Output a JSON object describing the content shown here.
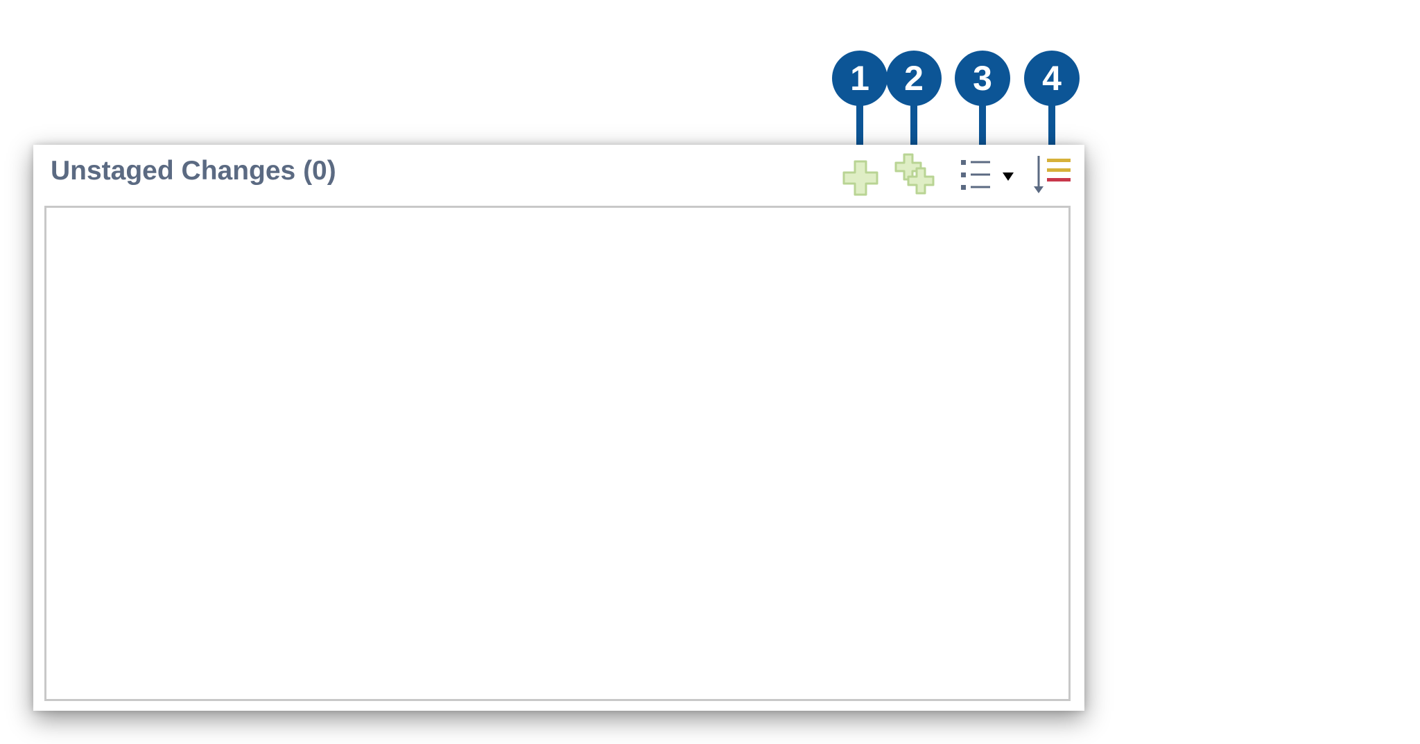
{
  "panel": {
    "title": "Unstaged Changes (0)"
  },
  "toolbar": {
    "icons": [
      "add-icon",
      "add-all-icon",
      "presentation-list-icon",
      "sort-icon"
    ],
    "colors": {
      "add_green_light": "#dfeec5",
      "add_green_stroke": "#b9d494",
      "list_blue": "#5b6a82",
      "sort_yellow": "#d6b13a",
      "sort_red": "#c8374b"
    }
  },
  "callouts": [
    {
      "number": "1"
    },
    {
      "number": "2"
    },
    {
      "number": "3"
    },
    {
      "number": "4"
    }
  ],
  "callout_color": "#0c5596"
}
